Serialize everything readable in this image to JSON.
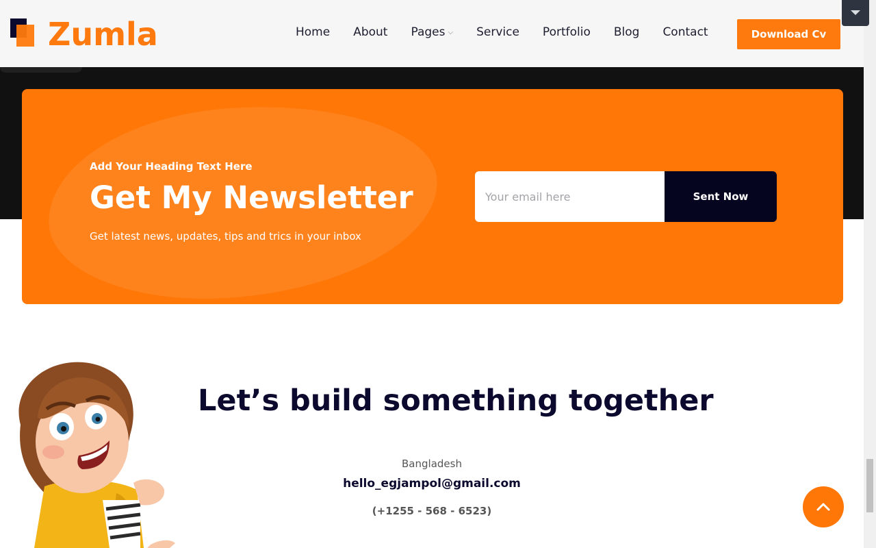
{
  "brand": {
    "name": "Zumla",
    "accent": "#ff7a0e",
    "dark": "#0b0a2e"
  },
  "nav": {
    "items": [
      {
        "label": "Home"
      },
      {
        "label": "About"
      },
      {
        "label": "Pages",
        "has_dropdown": true
      },
      {
        "label": "Service"
      },
      {
        "label": "Portfolio"
      },
      {
        "label": "Blog"
      },
      {
        "label": "Contact"
      }
    ],
    "cta_label": "Download Cv"
  },
  "newsletter": {
    "kicker": "Add Your Heading Text Here",
    "title": "Get My Newsletter",
    "subtitle": "Get latest news, updates, tips and trics in your inbox",
    "email_placeholder": "Your email here",
    "email_value": "",
    "button_label": "Sent Now"
  },
  "contact": {
    "title": "Let’s build something together",
    "country": "Bangladesh",
    "email": "hello_egjampol@gmail.com",
    "phone": "(+1255 - 568 - 6523)"
  },
  "icons": {
    "scroll_top": "chevron-up-icon",
    "dropdown": "caret-down-icon",
    "nav_dropdown": "chevron-down-icon"
  }
}
